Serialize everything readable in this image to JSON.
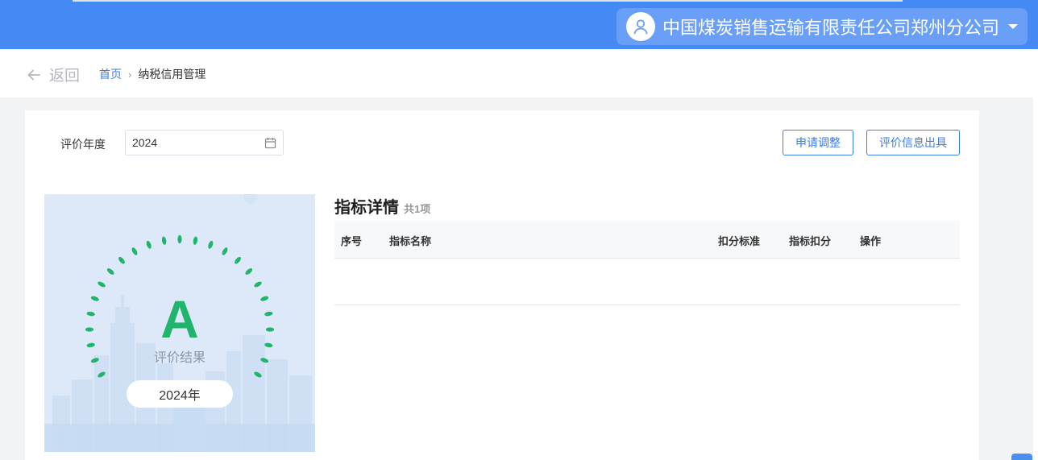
{
  "header": {
    "company_name": "中国煤炭销售运输有限责任公司郑州分公司",
    "avatar_icon": "user-icon",
    "dropdown_icon": "caret-down-icon"
  },
  "nav": {
    "back_label": "返回",
    "breadcrumb_home": "首页",
    "breadcrumb_sep": "›",
    "breadcrumb_current": "纳税信用管理"
  },
  "filter": {
    "year_label": "评价年度",
    "year_value": "2024",
    "calendar_icon": "calendar-icon"
  },
  "actions": {
    "adjust_label": "申请调整",
    "issue_label": "评价信息出具"
  },
  "result": {
    "grade": "A",
    "grade_caption": "评价结果",
    "year_pill": "2024年",
    "accent_color": "#21b46c"
  },
  "details": {
    "title": "指标详情",
    "count_text": "共1项",
    "columns": [
      "序号",
      "指标名称",
      "扣分标准",
      "指标扣分",
      "操作"
    ],
    "rows": []
  },
  "colors": {
    "brand": "#4589f5",
    "link": "#3d7ee6"
  }
}
